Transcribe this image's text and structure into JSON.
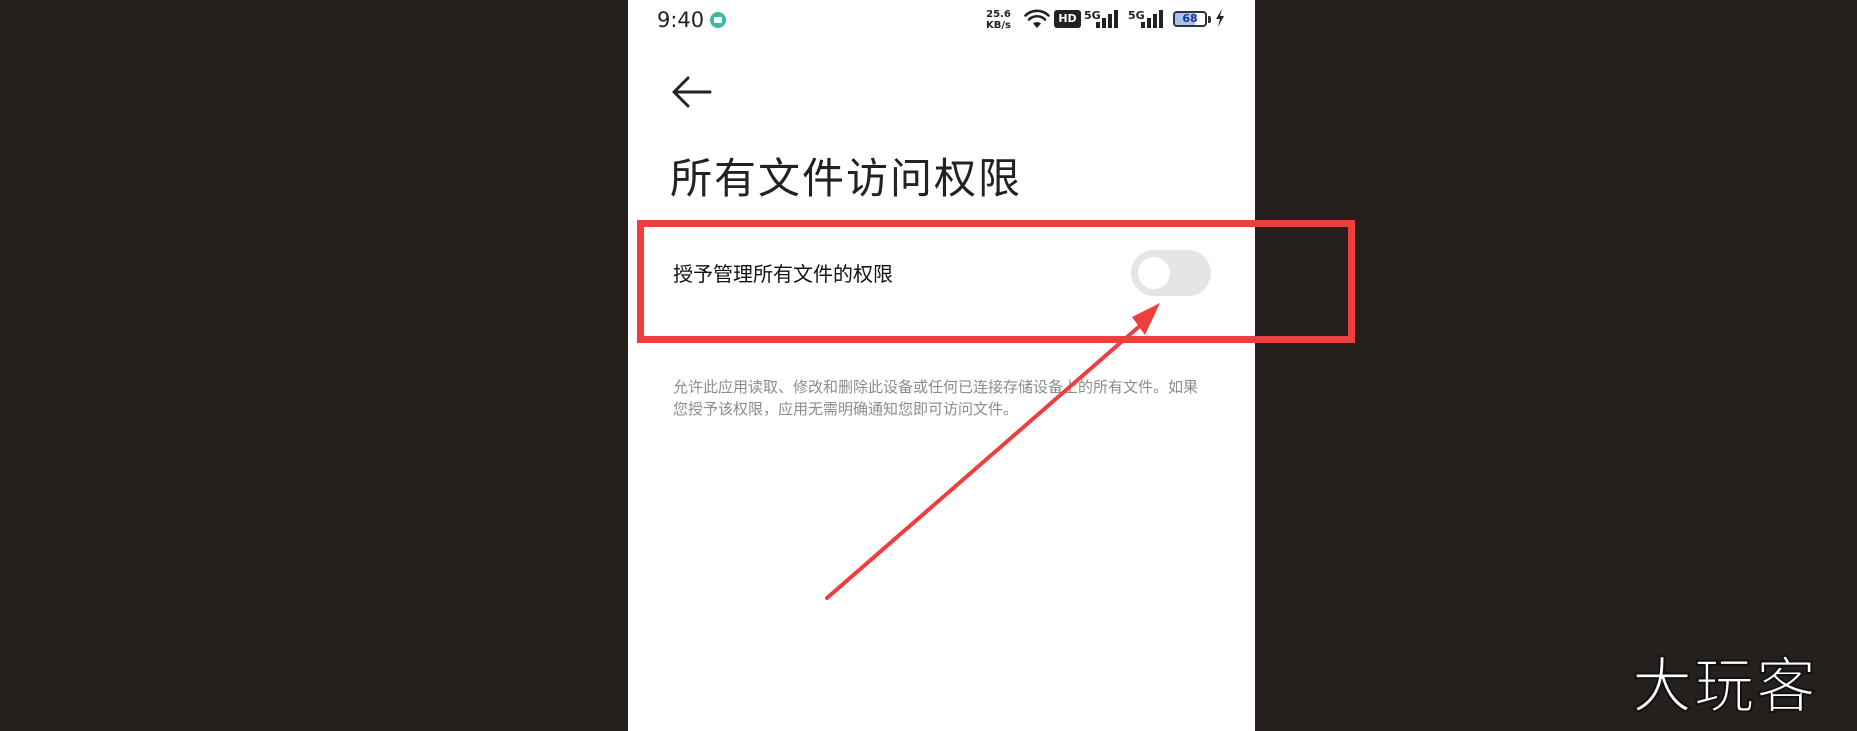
{
  "status_bar": {
    "time": "9:40",
    "net_speed_value": "25.6",
    "net_speed_unit": "KB/s",
    "hd_label": "HD",
    "network1": "5G",
    "network2": "5G",
    "battery_level": "68",
    "battery_percent": 68,
    "icons": [
      "notification-icon",
      "wifi-icon",
      "signal-icon",
      "signal-icon",
      "battery-icon",
      "charging-icon"
    ]
  },
  "page": {
    "title": "所有文件访问权限",
    "back_icon": "arrow-left-icon"
  },
  "setting": {
    "label": "授予管理所有文件的权限",
    "toggle_on": false
  },
  "description": "允许此应用读取、修改和删除此设备或任何已连接存储设备上的所有文件。如果您授予该权限，应用无需明确通知您即可访问文件。",
  "annotation": {
    "color": "#ef3e3e"
  },
  "watermark": "大玩客"
}
